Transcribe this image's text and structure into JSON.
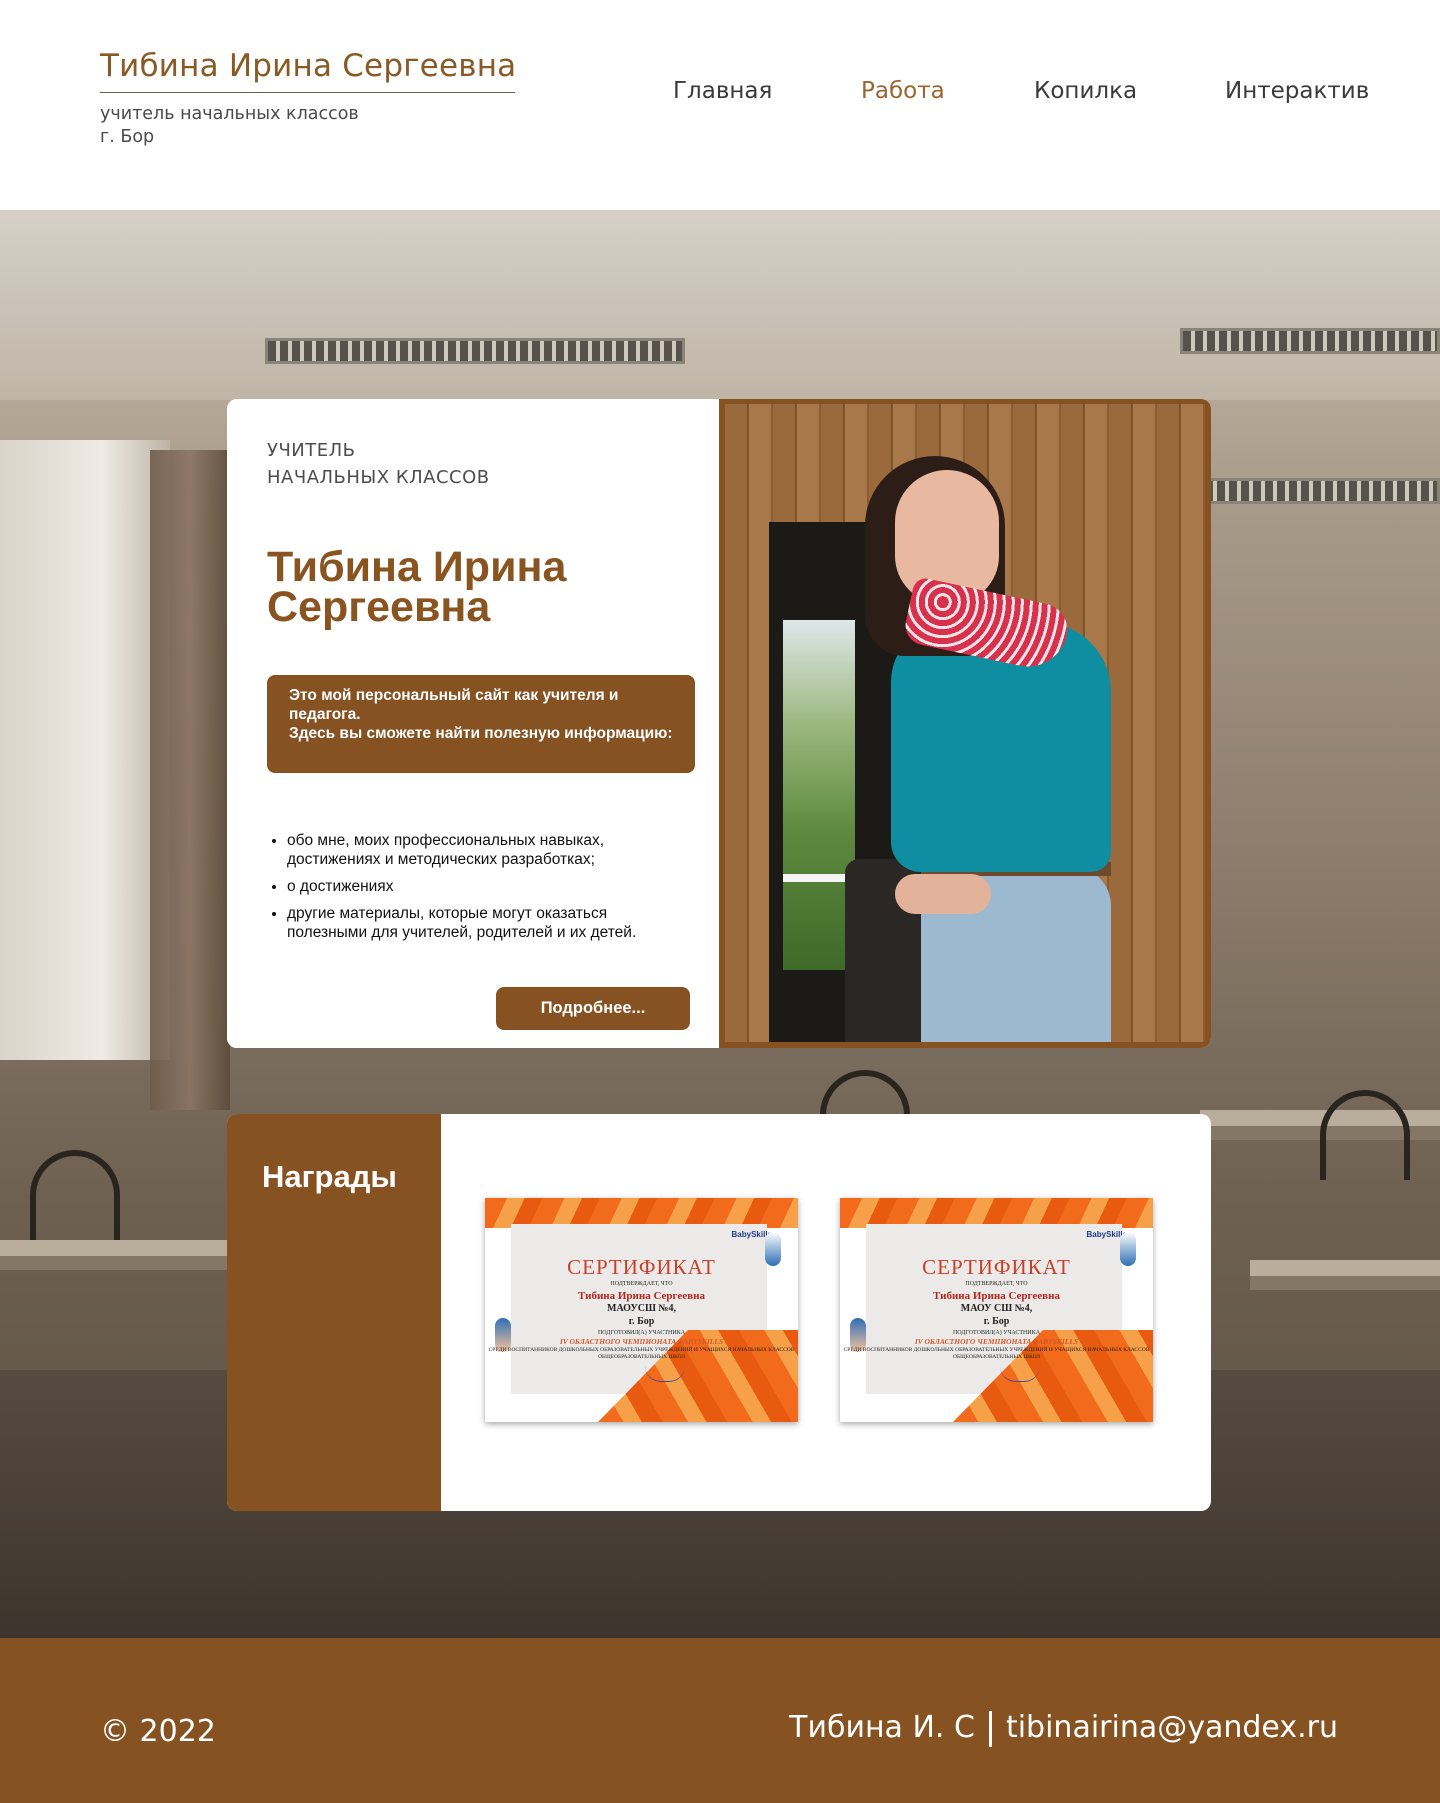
{
  "header": {
    "name": "Тибина Ирина Сергеевна",
    "subtitle_line1": "учитель начальных классов",
    "subtitle_line2": "г. Бор"
  },
  "nav": {
    "items": [
      {
        "label": "Главная",
        "active": false
      },
      {
        "label": "Работа",
        "active": true
      },
      {
        "label": "Копилка",
        "active": false
      },
      {
        "label": "Интерактив",
        "active": false
      }
    ]
  },
  "hero": {
    "role_line1": "УЧИТЕЛЬ",
    "role_line2": "НАЧАЛЬНЫХ КЛАССОВ",
    "name_line1": "Тибина Ирина",
    "name_line2": "Сергеевна",
    "intro_line1": "Это мой персональный сайт как учителя и педагога.",
    "intro_line2": "Здесь вы сможете найти полезную информацию:",
    "list": [
      "обо мне, моих профессиональных навыках, достижениях и методических разработках;",
      "о достижениях",
      "другие материалы, которые могут оказаться полезными для учителей, родителей и их детей."
    ],
    "more_button": "Подробнее...",
    "photo_icon": "portrait-photo"
  },
  "awards": {
    "title": "Награды",
    "certificates": [
      {
        "title": "СЕРТИФИКАТ",
        "confirm": "ПОДТВЕРЖДАЕТ, ЧТО",
        "name": "Тибина Ирина Сергеевна",
        "school": "МАОУСШ №4,",
        "city": "г. Бор",
        "prepared": "ПОДГОТОВИЛ(А) УЧАСТНИКА",
        "event": "IV ОБЛАСТНОГО ЧЕМПИОНАТА BABYSKILLS",
        "details": "СРЕДИ ВОСПИТАННИКОВ ДОШКОЛЬНЫХ ОБРАЗОВАТЕЛЬНЫХ УЧРЕЖДЕНИЙ И УЧАЩИХСЯ НАЧАЛЬНЫХ КЛАССОВ ОБЩЕОБРАЗОВАТЕЛЬНЫХ ШКОЛ",
        "brand": "BabySkills"
      },
      {
        "title": "СЕРТИФИКАТ",
        "confirm": "ПОДТВЕРЖДАЕТ, ЧТО",
        "name": "Тибина Ирина Сергеевна",
        "school": "МАОУ СШ №4,",
        "city": "г. Бор",
        "prepared": "ПОДГОТОВИЛ(А) УЧАСТНИКА",
        "event": "IV ОБЛАСТНОГО ЧЕМПИОНАТА BABYSKILLS",
        "details": "СРЕДИ ВОСПИТАННИКОВ ДОШКОЛЬНЫХ ОБРАЗОВАТЕЛЬНЫХ УЧРЕЖДЕНИЙ И УЧАЩИХСЯ НАЧАЛЬНЫХ КЛАССОВ ОБЩЕОБРАЗОВАТЕЛЬНЫХ ШКОЛ",
        "brand": "BabySkills"
      }
    ]
  },
  "footer": {
    "copyright": "© 2022",
    "author": "Тибина И. С",
    "email": "tibinairina@yandex.ru"
  },
  "colors": {
    "brand_brown": "#865222",
    "title_brown": "#8a5420",
    "nav_active": "#9a6530",
    "certificate_orange": "#f26a1b"
  }
}
